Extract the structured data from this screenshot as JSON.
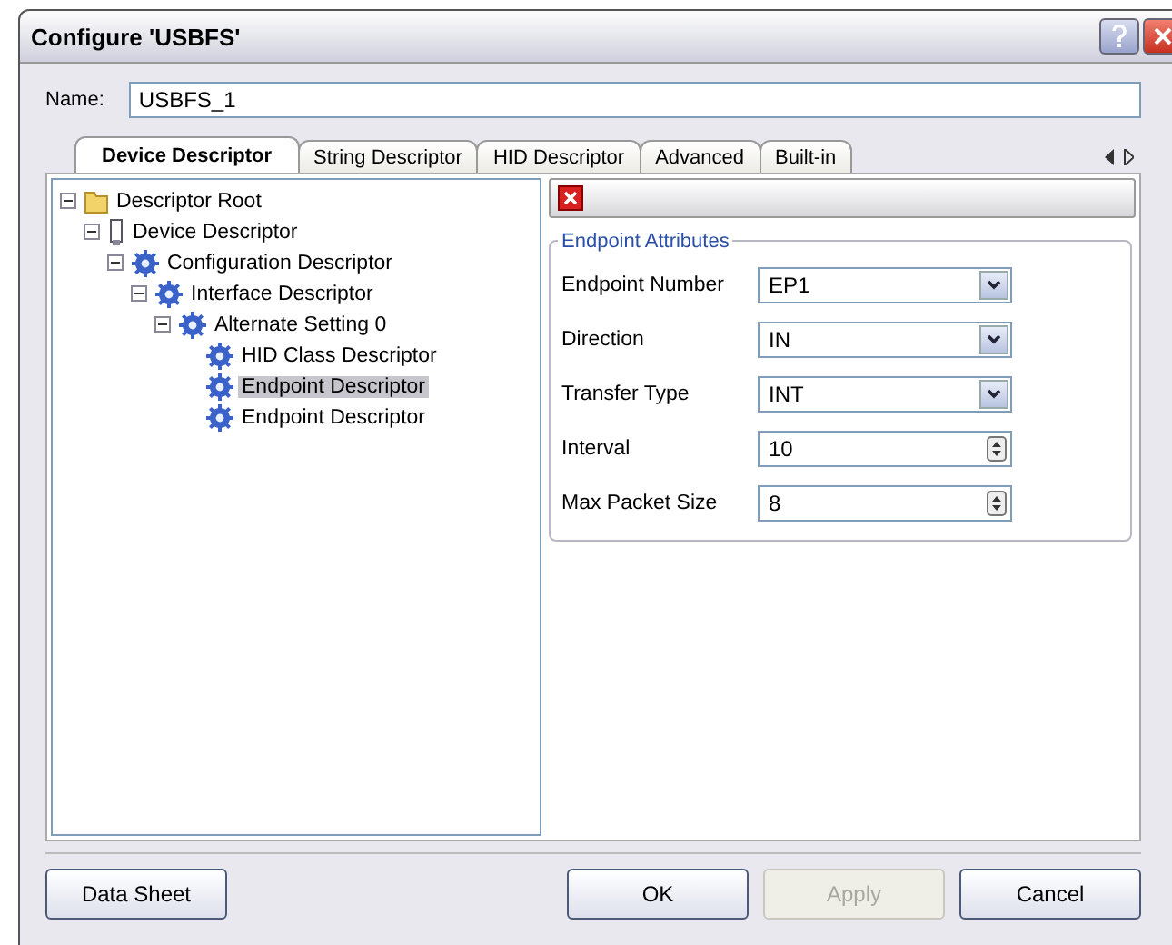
{
  "window": {
    "title": "Configure 'USBFS'"
  },
  "name_field": {
    "label": "Name:",
    "value": "USBFS_1"
  },
  "tabs": [
    {
      "label": "Device Descriptor",
      "selected": true
    },
    {
      "label": "String Descriptor",
      "selected": false
    },
    {
      "label": "HID Descriptor",
      "selected": false
    },
    {
      "label": "Advanced",
      "selected": false
    },
    {
      "label": "Built-in",
      "selected": false
    }
  ],
  "tree": [
    {
      "label": "Descriptor Root",
      "kind": "folder",
      "expanded": true,
      "selected": false,
      "children": [
        {
          "label": "Device Descriptor",
          "kind": "device",
          "expanded": true,
          "selected": false,
          "children": [
            {
              "label": "Configuration Descriptor",
              "kind": "gear",
              "expanded": true,
              "selected": false,
              "children": [
                {
                  "label": "Interface Descriptor",
                  "kind": "gear",
                  "expanded": true,
                  "selected": false,
                  "children": [
                    {
                      "label": "Alternate Setting 0",
                      "kind": "gear",
                      "expanded": true,
                      "selected": false,
                      "children": [
                        {
                          "label": "HID Class Descriptor",
                          "kind": "gear",
                          "selected": false
                        },
                        {
                          "label": "Endpoint Descriptor",
                          "kind": "gear",
                          "selected": true
                        },
                        {
                          "label": "Endpoint Descriptor",
                          "kind": "gear",
                          "selected": false
                        }
                      ]
                    }
                  ]
                }
              ]
            }
          ]
        }
      ]
    }
  ],
  "group": {
    "title": "Endpoint Attributes",
    "fields": [
      {
        "label": "Endpoint Number",
        "kind": "combo",
        "value": "EP1"
      },
      {
        "label": "Direction",
        "kind": "combo",
        "value": "IN"
      },
      {
        "label": "Transfer Type",
        "kind": "combo",
        "value": "INT"
      },
      {
        "label": "Interval",
        "kind": "spin",
        "value": "10"
      },
      {
        "label": "Max Packet Size",
        "kind": "spin",
        "value": "8"
      }
    ]
  },
  "buttons": [
    {
      "label": "Data Sheet",
      "disabled": false
    },
    {
      "label": "OK",
      "disabled": false
    },
    {
      "label": "Apply",
      "disabled": true
    },
    {
      "label": "Cancel",
      "disabled": false
    }
  ]
}
